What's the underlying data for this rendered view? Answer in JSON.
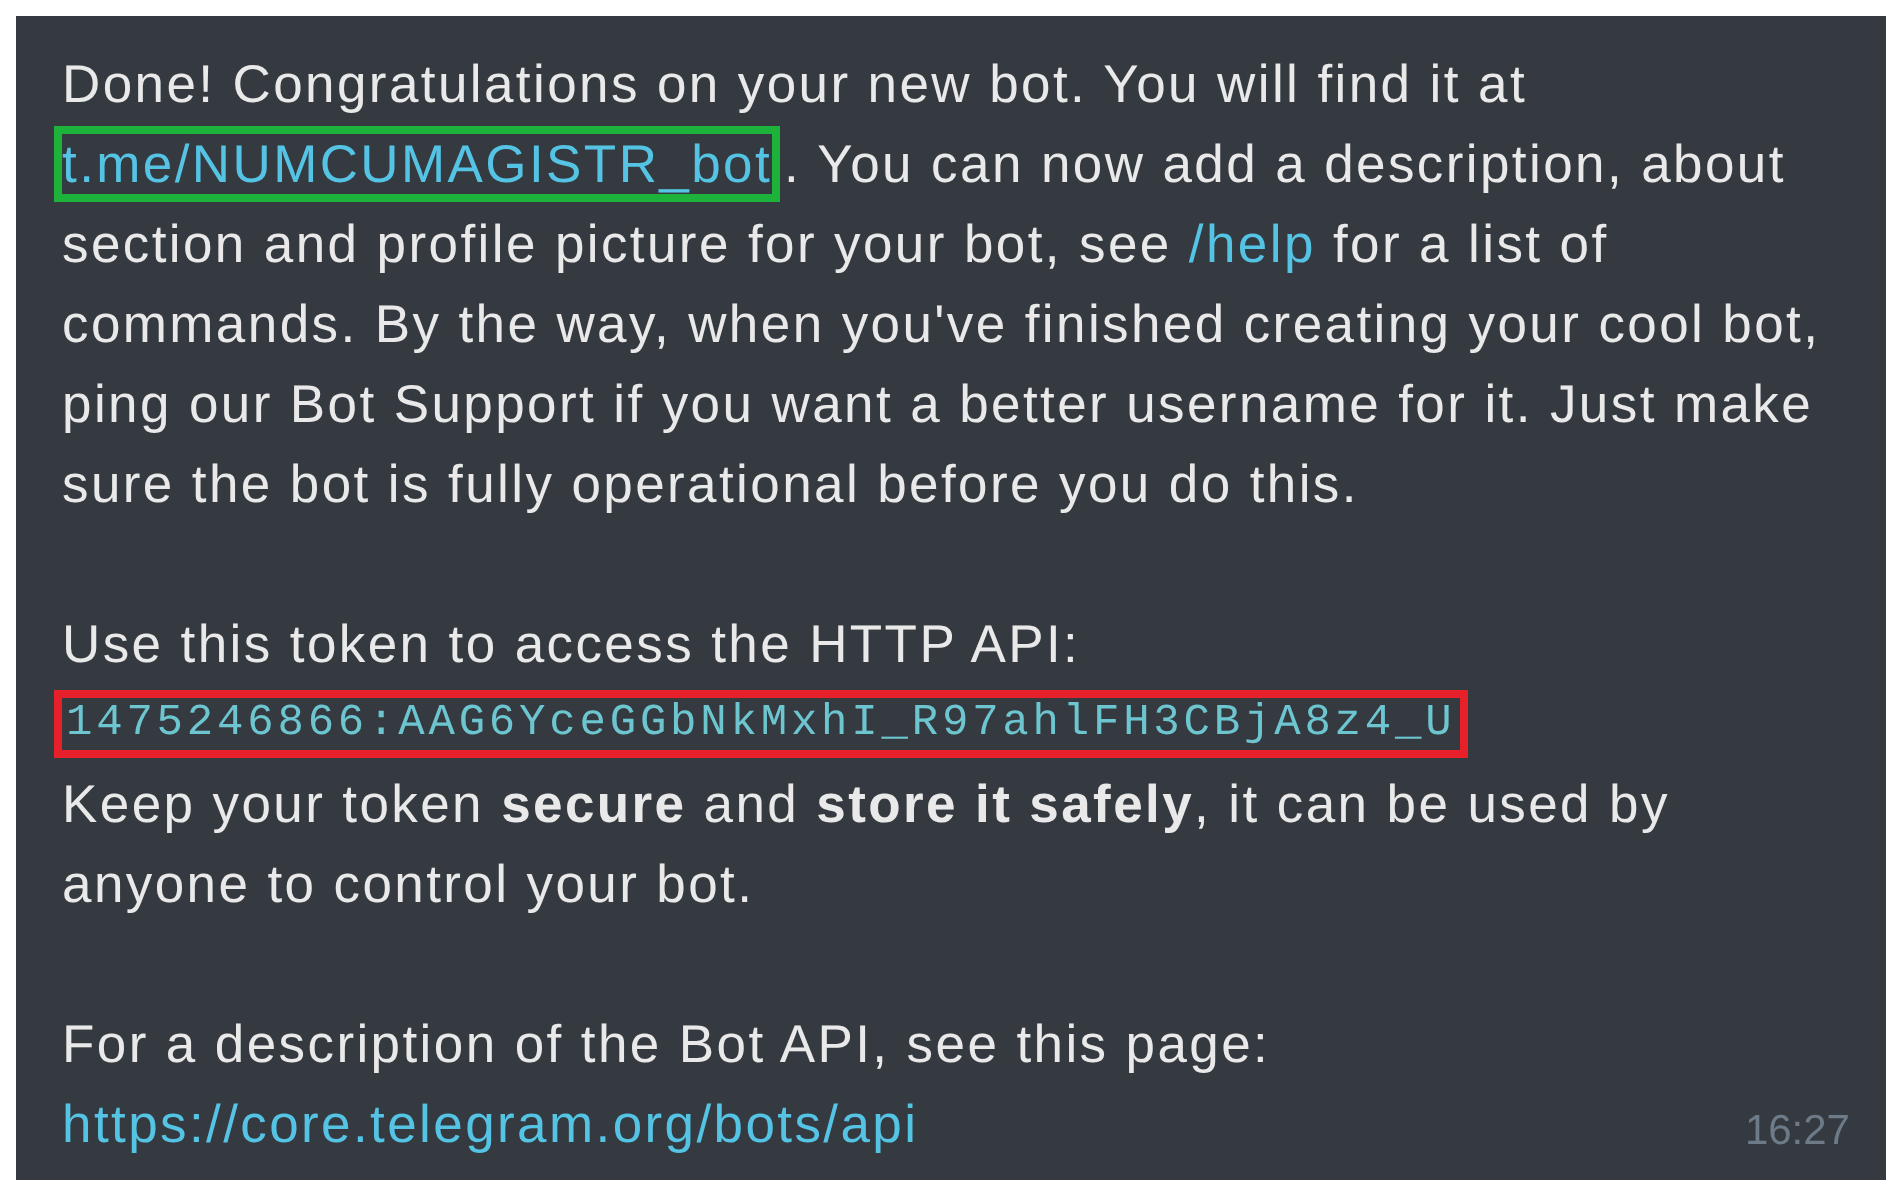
{
  "message": {
    "intro": {
      "before_link": "Done! Congratulations on your new bot. You will find it at",
      "bot_link": {
        "text": "t.me/NUMCUMAGISTR_bot",
        "color": "#1db33a"
      },
      "middle": ". You can now add a description, about section and profile picture for your bot, see",
      "help_link": "/help",
      "after": "for a list of commands. By the way, when you've finished creating your cool bot, ping our Bot Support if you want a better username for it. Just make sure the bot is fully operational before you do this."
    },
    "token_label": "Use this token to access the HTTP API:",
    "token": {
      "text": "1475246866:AAG6YceGGbNkMxhI_R97ahlFH3CBjA8z4_U",
      "color": "#e8202a"
    },
    "token_note": "Keep your token **secure** and **store it safely**, it can be used by anyone to control your bot.",
    "api_label": "For a description of the Bot API, see this page:",
    "api_link": "https://core.telegram.org/bots/api",
    "time": "16:27"
  }
}
